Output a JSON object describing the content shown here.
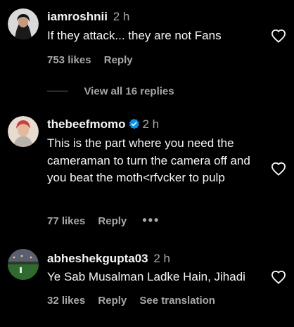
{
  "comments": [
    {
      "username": "iamroshnii",
      "time": "2 h",
      "text": "If they attack... they are not Fans",
      "likes": "753 likes",
      "reply": "Reply",
      "verified": false
    },
    {
      "username": "thebeefmomo",
      "time": "2 h",
      "text": "This is the part where you need the cameraman to turn the camera off and you beat the moth<rfvcker to pulp",
      "likes": "77 likes",
      "reply": "Reply",
      "more": "•••",
      "verified": true
    },
    {
      "username": "abheshekgupta03",
      "time": "2 h",
      "text": "Ye Sab Musalman Ladke Hain, Jihadi",
      "likes": "32 likes",
      "reply": "Reply",
      "see_translation": "See translation",
      "verified": false
    }
  ],
  "view_replies": "View all 16 replies",
  "colors": {
    "background": "#000000",
    "primary_text": "#f5f5f5",
    "secondary_text": "#a8a8a8",
    "verified_badge": "#0095f6"
  },
  "icons": {
    "like": "heart-outline-icon",
    "verified": "verified-badge-icon",
    "more": "more-options-icon"
  }
}
